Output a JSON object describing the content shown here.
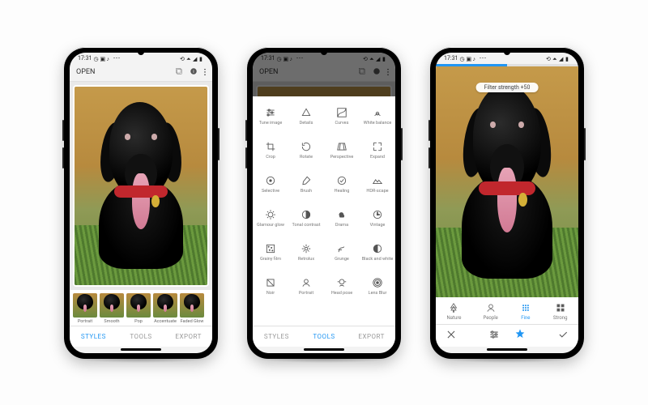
{
  "status_bar": {
    "time": "17:31",
    "left_icons": [
      "clock",
      "briefcase",
      "circle",
      "tiktok"
    ],
    "right_icons": [
      "nfc",
      "wifi",
      "signal",
      "battery"
    ]
  },
  "app_bar": {
    "open_label": "OPEN",
    "action_icons": [
      "photo-stack-icon",
      "info-icon",
      "more-vert-icon"
    ]
  },
  "image": {
    "subject": "black dog with tongue out on grass"
  },
  "phone1": {
    "style_thumbs": [
      {
        "label": "Portrait"
      },
      {
        "label": "Smooth"
      },
      {
        "label": "Pop"
      },
      {
        "label": "Accentuate"
      },
      {
        "label": "Faded Glow"
      }
    ],
    "tabs": {
      "styles": "STYLES",
      "tools": "TOOLS",
      "export": "EXPORT",
      "active": "styles"
    }
  },
  "phone2": {
    "tools": [
      {
        "icon": "tune",
        "label": "Tune image"
      },
      {
        "icon": "details",
        "label": "Details"
      },
      {
        "icon": "curves",
        "label": "Curves"
      },
      {
        "icon": "wb",
        "label": "White balance"
      },
      {
        "icon": "crop",
        "label": "Crop"
      },
      {
        "icon": "rotate",
        "label": "Rotate"
      },
      {
        "icon": "perspective",
        "label": "Perspective"
      },
      {
        "icon": "expand",
        "label": "Expand"
      },
      {
        "icon": "selective",
        "label": "Selective"
      },
      {
        "icon": "brush",
        "label": "Brush"
      },
      {
        "icon": "healing",
        "label": "Healing"
      },
      {
        "icon": "hdr",
        "label": "HDR-scape"
      },
      {
        "icon": "glamour",
        "label": "Glamour glow"
      },
      {
        "icon": "tonal",
        "label": "Tonal contrast"
      },
      {
        "icon": "drama",
        "label": "Drama"
      },
      {
        "icon": "vintage",
        "label": "Vintage"
      },
      {
        "icon": "grainy",
        "label": "Grainy film"
      },
      {
        "icon": "retrolux",
        "label": "Retrolux"
      },
      {
        "icon": "grunge",
        "label": "Grunge"
      },
      {
        "icon": "bw",
        "label": "Black and white"
      },
      {
        "icon": "noir",
        "label": "Noir"
      },
      {
        "icon": "portrait",
        "label": "Portrait"
      },
      {
        "icon": "headpose",
        "label": "Head pose"
      },
      {
        "icon": "lensblur",
        "label": "Lens Blur"
      }
    ],
    "tabs": {
      "styles": "STYLES",
      "tools": "TOOLS",
      "export": "EXPORT",
      "active": "tools"
    }
  },
  "phone3": {
    "chip_label": "Filter strength +50",
    "progress_pct": 50,
    "options": [
      {
        "icon": "nature",
        "label": "Nature"
      },
      {
        "icon": "people",
        "label": "People"
      },
      {
        "icon": "fine",
        "label": "Fine"
      },
      {
        "icon": "strong",
        "label": "Strong"
      }
    ],
    "active_option": 2,
    "editbar_icons": [
      "close",
      "sliders",
      "styles",
      "apply"
    ],
    "editbar_active": 2
  }
}
